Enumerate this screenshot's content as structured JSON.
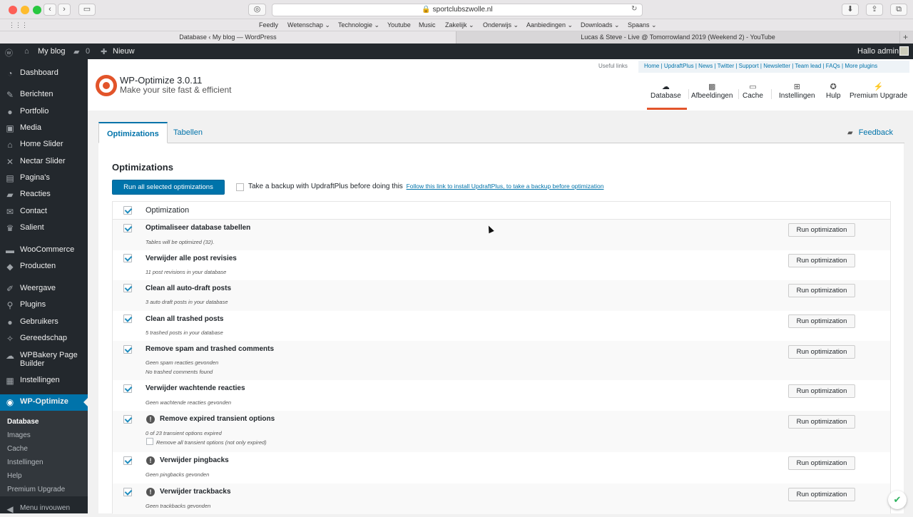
{
  "browser": {
    "url": "sportclubszwolle.nl",
    "bookmarks": [
      "Feedly",
      "Wetenschap ⌄",
      "Technologie ⌄",
      "Youtube",
      "Music",
      "Zakelijk ⌄",
      "Onderwijs ⌄",
      "Aanbiedingen ⌄",
      "Downloads ⌄",
      "Spaans ⌄"
    ],
    "tabs": [
      "Database ‹ My blog — WordPress",
      "Lucas & Steve - Live @ Tomorrowland 2019 (Weekend 2) - YouTube"
    ]
  },
  "adminbar": {
    "site_name": "My blog",
    "comments_count": "0",
    "new_label": "Nieuw",
    "greeting": "Hallo admin"
  },
  "sidebar": {
    "items": [
      {
        "label": "Dashboard",
        "icon": "dashboard-icon"
      },
      {
        "label": "Berichten",
        "icon": "pin-icon"
      },
      {
        "label": "Portfolio",
        "icon": "portfolio-icon"
      },
      {
        "label": "Media",
        "icon": "media-icon"
      },
      {
        "label": "Home Slider",
        "icon": "home-slider-icon"
      },
      {
        "label": "Nectar Slider",
        "icon": "nectar-slider-icon"
      },
      {
        "label": "Pagina's",
        "icon": "page-icon"
      },
      {
        "label": "Reacties",
        "icon": "comment-icon"
      },
      {
        "label": "Contact",
        "icon": "mail-icon"
      },
      {
        "label": "Salient",
        "icon": "salient-icon"
      },
      {
        "label": "WooCommerce",
        "icon": "woocommerce-icon"
      },
      {
        "label": "Producten",
        "icon": "product-icon"
      },
      {
        "label": "Weergave",
        "icon": "brush-icon"
      },
      {
        "label": "Plugins",
        "icon": "plugin-icon"
      },
      {
        "label": "Gebruikers",
        "icon": "users-icon"
      },
      {
        "label": "Gereedschap",
        "icon": "wrench-icon"
      },
      {
        "label": "WPBakery Page Builder",
        "icon": "wpbakery-icon"
      },
      {
        "label": "Instellingen",
        "icon": "settings-icon"
      },
      {
        "label": "WP-Optimize",
        "icon": "wp-optimize-icon"
      }
    ],
    "submenu": [
      "Database",
      "Images",
      "Cache",
      "Instellingen",
      "Help",
      "Premium Upgrade"
    ],
    "collapse_label": "Menu invouwen"
  },
  "wpo": {
    "title": "WP-Optimize 3.0.11",
    "subtitle": "Make your site fast & efficient",
    "useful_label": "Useful links",
    "useful_links": "Home | UpdraftPlus | News | Twitter | Support | Newsletter | Team lead | FAQs | More plugins",
    "nav": [
      {
        "label": "Database",
        "icon": "cloud-icon"
      },
      {
        "label": "Afbeeldingen",
        "icon": "images-icon"
      },
      {
        "label": "Cache",
        "icon": "cache-icon"
      },
      {
        "label": "Instellingen",
        "icon": "sliders-icon"
      },
      {
        "label": "Hulp",
        "icon": "lifebuoy-icon"
      },
      {
        "label": "Premium Upgrade",
        "icon": "plug-icon"
      }
    ],
    "tabs": [
      "Optimizations",
      "Tabellen"
    ],
    "feedback": "Feedback",
    "heading": "Optimizations",
    "run_all": "Run all selected optimizations",
    "backup_text": "Take a backup with UpdraftPlus before doing this",
    "backup_link": "Follow this link to install UpdraftPlus, to take a backup before optimization",
    "table_header": "Optimization",
    "run_label": "Run optimization",
    "rows": [
      {
        "title": "Optimaliseer database tabellen",
        "details": [
          "Tables will be optimized (32)."
        ]
      },
      {
        "title": "Verwijder alle post revisies",
        "details": [
          "11 post revisions in your database"
        ]
      },
      {
        "title": "Clean all auto-draft posts",
        "details": [
          "3 auto draft posts in your database"
        ]
      },
      {
        "title": "Clean all trashed posts",
        "details": [
          "5 trashed posts in your database"
        ]
      },
      {
        "title": "Remove spam and trashed comments",
        "details": [
          "Geen spam reacties gevonden",
          "No trashed comments found"
        ]
      },
      {
        "title": "Verwijder wachtende reacties",
        "details": [
          "Geen wachtende reacties gevonden"
        ]
      },
      {
        "title": "Remove expired transient options",
        "details": [
          "0 of 23 transient options expired"
        ],
        "sub_option": "Remove all transient options (not only expired)",
        "warning": true
      },
      {
        "title": "Verwijder pingbacks",
        "details": [
          "Geen pingbacks gevonden"
        ],
        "warning": true
      },
      {
        "title": "Verwijder trackbacks",
        "details": [
          "Geen trackbacks gevonden"
        ],
        "warning": true
      }
    ]
  }
}
